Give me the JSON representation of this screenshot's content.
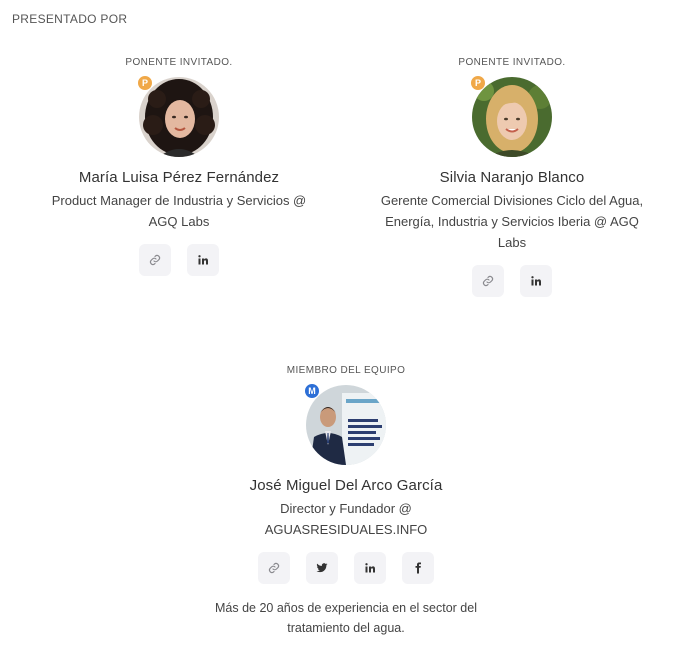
{
  "section_title": "PRESENTADO POR",
  "speakers": [
    {
      "role": "PONENTE INVITADO.",
      "badge": "P",
      "badge_color": "#f0a848",
      "name": "María Luisa Pérez Fernández",
      "title_line1": "Product Manager de Industria y Servicios @",
      "title_line2": "AGQ Labs",
      "social_icons": [
        "link-icon",
        "linkedin-icon"
      ]
    },
    {
      "role": "PONENTE INVITADO.",
      "badge": "P",
      "badge_color": "#f0a848",
      "name": "Silvia Naranjo Blanco",
      "title_line1": "Gerente Comercial Divisiones Ciclo del Agua,",
      "title_line2": "Energía, Industria y Servicios Iberia @ AGQ",
      "title_line3": "Labs",
      "social_icons": [
        "link-icon",
        "linkedin-icon"
      ]
    },
    {
      "role": "MIEMBRO DEL EQUIPO",
      "badge": "M",
      "badge_color": "#2d6fd6",
      "name": "José Miguel Del Arco García",
      "title_line1": "Director y Fundador @",
      "title_line2": "AGUASRESIDUALES.INFO",
      "social_icons": [
        "link-icon",
        "twitter-icon",
        "linkedin-icon",
        "facebook-icon"
      ],
      "bio_line1": "Más de 20 años de experiencia en el sector del",
      "bio_line2": "tratamiento del agua."
    }
  ]
}
